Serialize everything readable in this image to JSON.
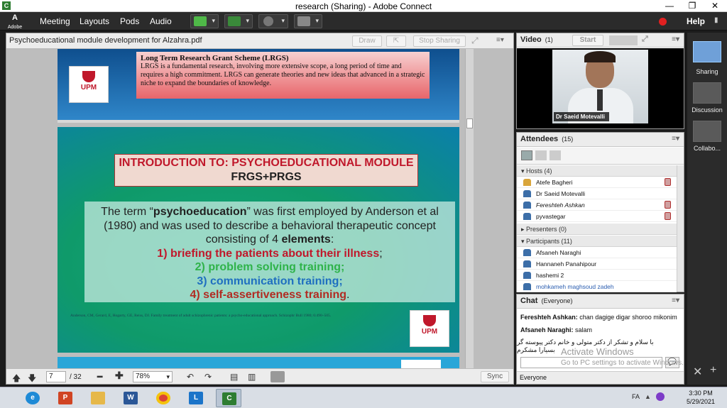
{
  "window": {
    "title": "research (Sharing) - Adobe Connect",
    "controls": [
      "—",
      "❐",
      "✕"
    ]
  },
  "menubar": {
    "logo_top": "A",
    "logo_bottom": "Adobe",
    "items": [
      "Meeting",
      "Layouts",
      "Pods",
      "Audio"
    ],
    "help": "Help",
    "record_color": "#e02020"
  },
  "share": {
    "title": "Psychoeducational module development for Alzahra.pdf",
    "draw": "Draw",
    "stop": "Stop Sharing",
    "page_value": "7",
    "page_total": "/ 32",
    "zoom": "78%",
    "sync": "Sync"
  },
  "slide1": {
    "heading": "Long Term Research Grant Scheme (LRGS)",
    "text": "LRGS is a fundamental research, involving more extensive scope, a long period of time and requires a high commitment. LRGS can generate theories and new ideas that advanced in a strategic niche to expand the boundaries of knowledge.",
    "logo": "UPM"
  },
  "slide2": {
    "title1": "INTRODUCTION TO: PSYCHOEDUCATIONAL MODULE",
    "title2": "FRGS+PRGS",
    "intro_a": "The term “",
    "intro_b": "psychoeducation",
    "intro_c": "” was first employed by Anderson et al (1980) and was used to describe a behavioral therapeutic concept consisting of 4 ",
    "intro_d": "elements",
    "intro_e": ":",
    "e1": "1) briefing the patients about their illness",
    "e1_suffix": ";",
    "e2": "2) problem solving training;",
    "e3": "3) communication training;",
    "e4": "4) self-assertiveness training",
    "e4_suffix": ".",
    "citation": "Anderson, CM, Gerard, E, Hogarty, GE, Reiss, DJ. Family treatment of adult schizophrenic patients: a psycho-educational approach. Schizophr Bull 1980; 6:490–505.",
    "logo": "UPM"
  },
  "video": {
    "title": "Video",
    "count": "(1)",
    "start": "Start",
    "name": "Dr Saeid Motevalli"
  },
  "attendees": {
    "title": "Attendees",
    "count": "(15)",
    "hosts_label": "Hosts (4)",
    "hosts": [
      "Atefe Bagheri",
      "Dr Saeid Motevalli",
      "Fereshteh Ashkan",
      "pyvastegar"
    ],
    "presenters_label": "Presenters (0)",
    "participants_label": "Participants (11)",
    "participants": [
      "Afsaneh Naraghi",
      "Hannaneh Panahipour",
      "hashemi 2",
      "mohkameh maghsoud zadeh"
    ]
  },
  "chat": {
    "title": "Chat",
    "scope": "(Everyone)",
    "m1_name": "Fereshteh Ashkan:",
    "m1_text": "chan dagige digar shoroo mikonim",
    "m2_name": "Afsaneh Naraghi:",
    "m2_text": "salam",
    "m3_text": "با سلام و تشکر از دکتر متولی و خانم دکتر پیوسته گر بسیارا مشکرم",
    "tab": "Everyone"
  },
  "watermark": {
    "line1": "Activate Windows",
    "line2": "Go to PC settings to activate Windows."
  },
  "layouts": [
    "Sharing",
    "Discussion",
    "Collabo..."
  ],
  "taskbar": {
    "lang": "FA",
    "time": "3:30 PM",
    "date": "5/29/2021"
  }
}
